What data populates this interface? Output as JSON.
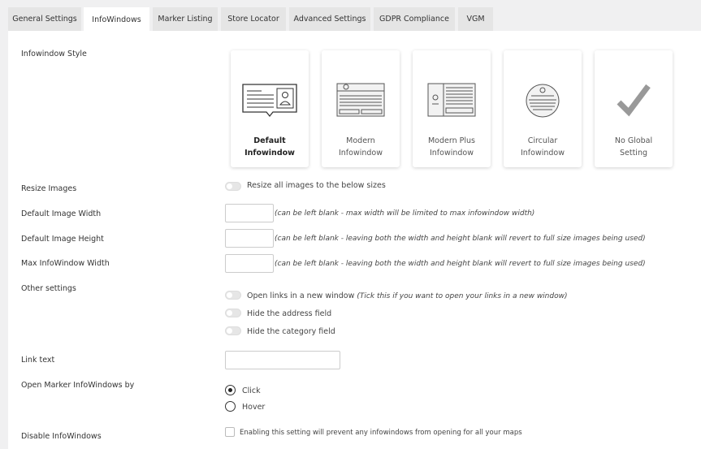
{
  "tabs": [
    "General Settings",
    "InfoWindows",
    "Marker Listing",
    "Store Locator",
    "Advanced Settings",
    "GDPR Compliance",
    "VGM"
  ],
  "active_tab": "InfoWindows",
  "labels": {
    "style": "Infowindow Style",
    "resize": "Resize Images",
    "img_width": "Default Image Width",
    "img_height": "Default Image Height",
    "max_width": "Max InfoWindow Width",
    "other": "Other settings",
    "link_text": "Link text",
    "open_by": "Open Marker InfoWindows by",
    "disable": "Disable InfoWindows"
  },
  "styles": [
    {
      "line1": "Default",
      "line2": "Infowindow",
      "selected": true
    },
    {
      "line1": "Modern",
      "line2": "Infowindow",
      "selected": false
    },
    {
      "line1": "Modern Plus",
      "line2": "Infowindow",
      "selected": false
    },
    {
      "line1": "Circular",
      "line2": "Infowindow",
      "selected": false
    },
    {
      "line1": "No Global",
      "line2": "Setting",
      "selected": false
    }
  ],
  "resize_toggle": "Resize all images to the below sizes",
  "hints": {
    "img_width": "(can be left blank - max width will be limited to max infowindow width)",
    "img_height": "(can be left blank - leaving both the width and height blank will revert to full size images being used)",
    "max_width": "(can be left blank - leaving both the width and height blank will revert to full size images being used)"
  },
  "other": {
    "new_window": "Open links in a new window",
    "new_window_hint": "(Tick this if you want to open your links in a new window)",
    "hide_address": "Hide the address field",
    "hide_category": "Hide the category field"
  },
  "link_text_value": "",
  "open_by": {
    "click": "Click",
    "hover": "Hover",
    "selected": "Click"
  },
  "disable_text": "Enabling this setting will prevent any infowindows from opening for all your maps"
}
